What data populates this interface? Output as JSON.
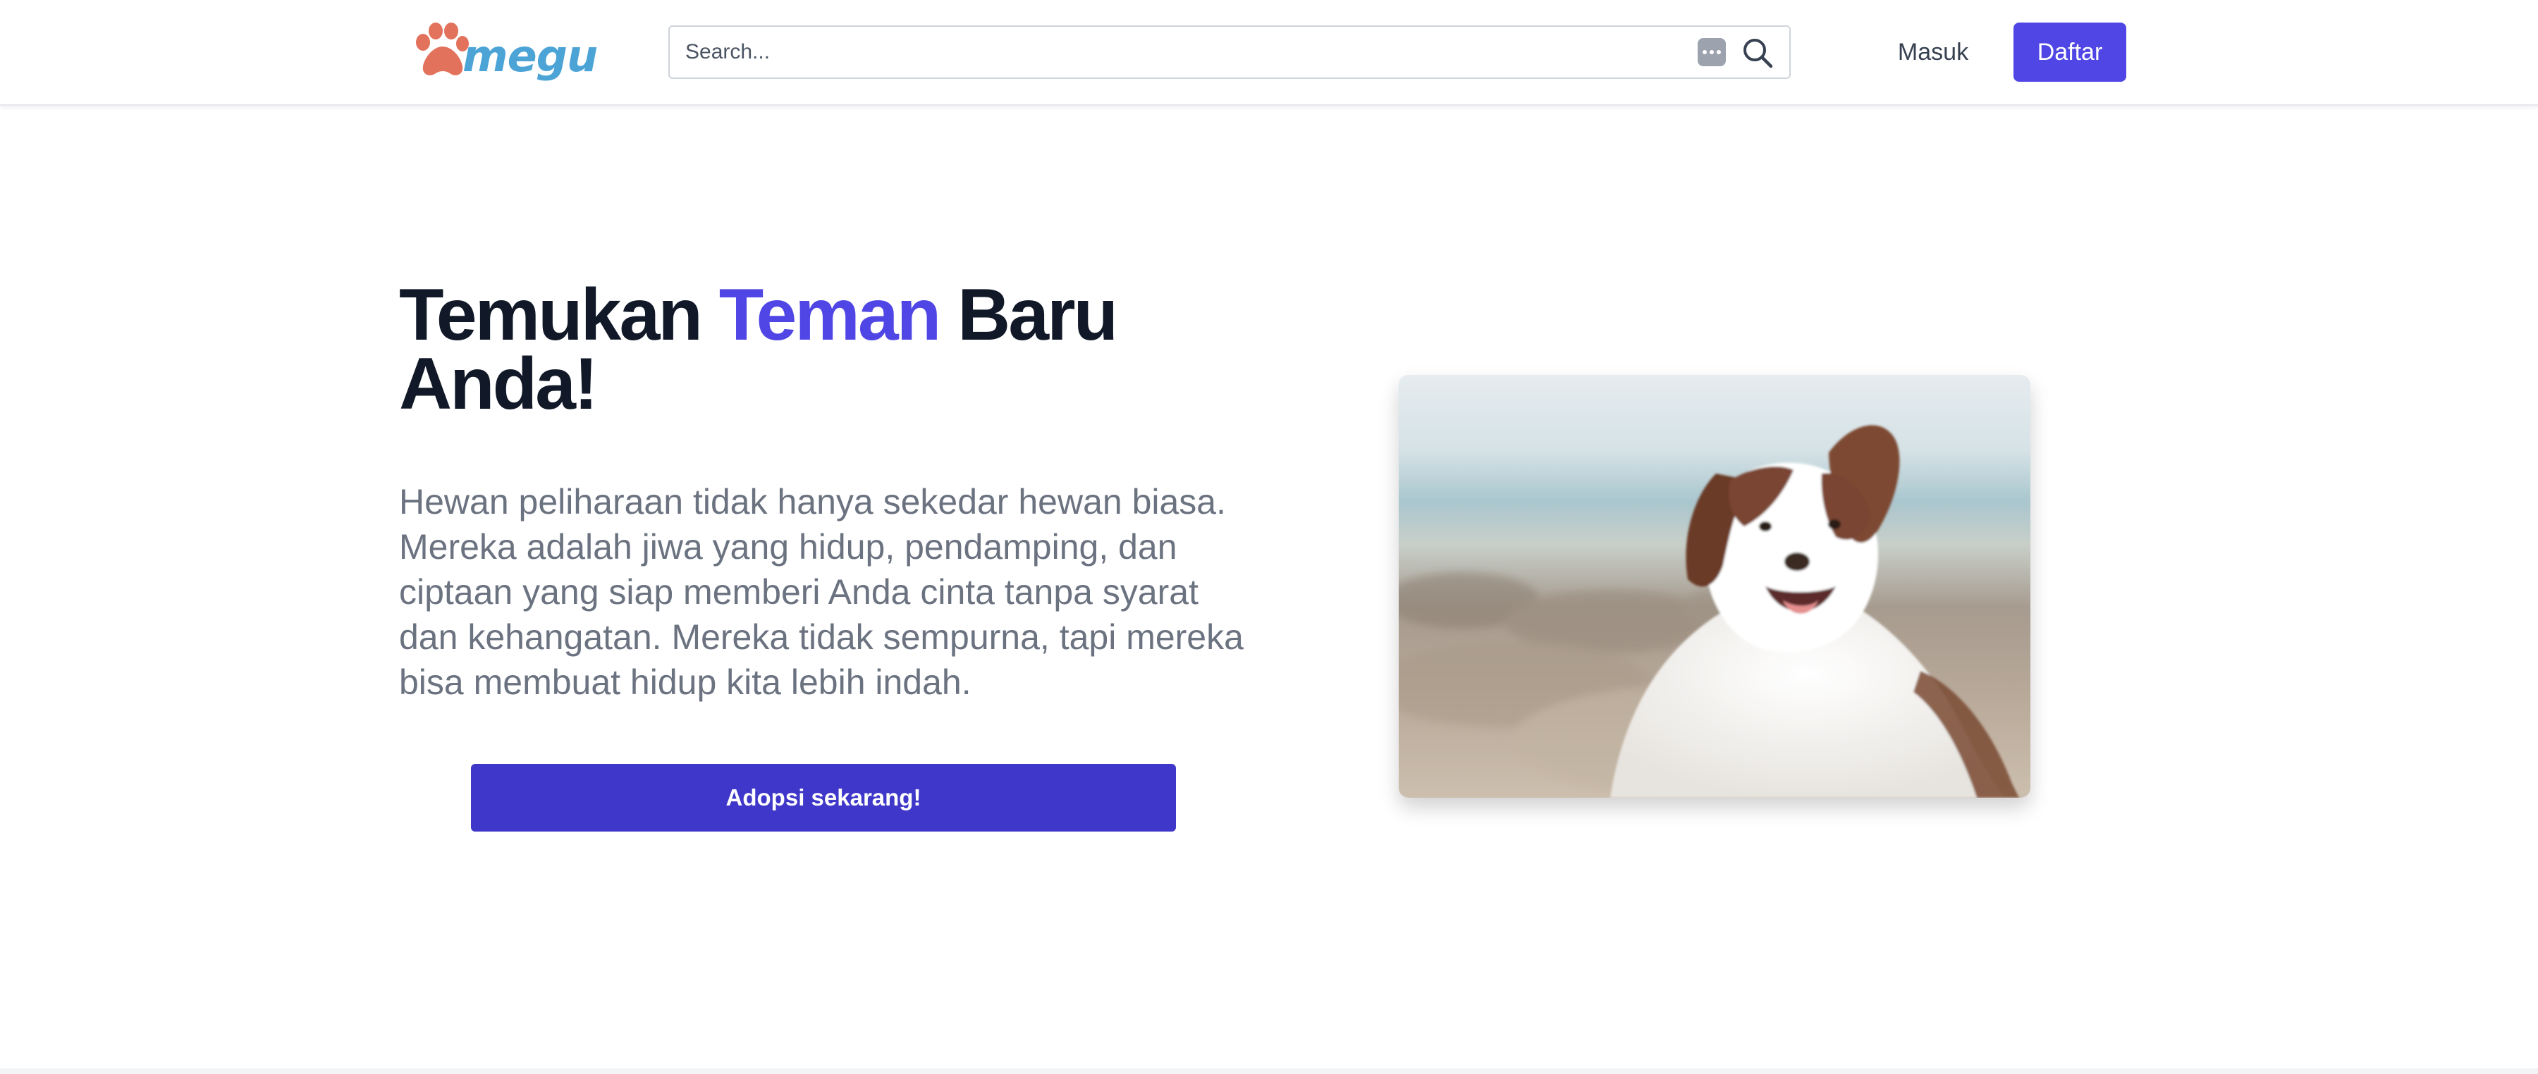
{
  "brand": {
    "logo_text": "megu",
    "logo_icon": "paw-icon",
    "logo_icon_color": "#e2725b",
    "logo_text_color": "#4ba3d6"
  },
  "header": {
    "search": {
      "placeholder": "Search...",
      "more_icon": "more-dots-icon",
      "search_icon": "search-icon"
    },
    "login_label": "Masuk",
    "register_label": "Daftar"
  },
  "hero": {
    "title_part1": "Temukan ",
    "title_accent": "Teman",
    "title_part2": " Baru Anda!",
    "description": "Hewan peliharaan tidak hanya sekedar hewan biasa. Mereka adalah jiwa yang hidup, pendamping, dan ciptaan yang siap memberi Anda cinta tanpa syarat dan kehangatan. Mereka tidak sempurna, tapi mereka bisa membuat hidup kita lebih indah.",
    "cta_label": "Adopsi sekarang!"
  },
  "colors": {
    "accent": "#4f46e5",
    "cta_background": "#3f37c9",
    "title_text": "#111827",
    "body_text": "#6b7280"
  }
}
